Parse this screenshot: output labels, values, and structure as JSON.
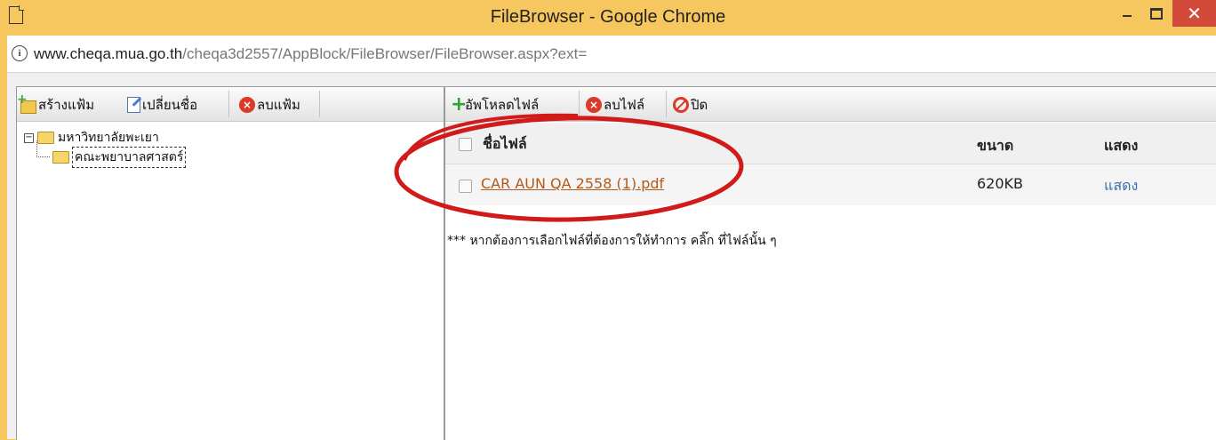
{
  "window": {
    "title": "FileBrowser - Google Chrome",
    "close_glyph": "✕"
  },
  "address": {
    "host": "www.cheqa.mua.go.th",
    "path": "/cheqa3d2557/AppBlock/FileBrowser/FileBrowser.aspx?ext="
  },
  "left_toolbar": {
    "new_folder": "สร้างแฟ้ม",
    "rename": "เปลี่ยนชื่อ",
    "delete_folder": "ลบแฟ้ม"
  },
  "tree": {
    "root": "มหาวิทยาลัยพะเยา",
    "child": "คณะพยาบาลศาสตร์"
  },
  "right_toolbar": {
    "upload": "อัพโหลดไฟล์",
    "delete_file": "ลบไฟล์",
    "close": "ปิด"
  },
  "file_grid": {
    "headers": {
      "name": "ชื่อไฟล์",
      "size": "ขนาด",
      "view": "แสดง"
    },
    "rows": [
      {
        "name": "CAR AUN QA 2558 (1).pdf",
        "size": "620KB",
        "view": "แสดง"
      }
    ]
  },
  "note": "*** หากต้องการเลือกไฟล์ที่ต้องการให้ทำการ คลิ๊ก ที่ไฟล์นั้น ๆ",
  "colors": {
    "titlebar": "#f6c75e",
    "close_button": "#d44a3a",
    "annotation_ellipse": "#d11a1a",
    "file_link": "#b35a1a"
  }
}
